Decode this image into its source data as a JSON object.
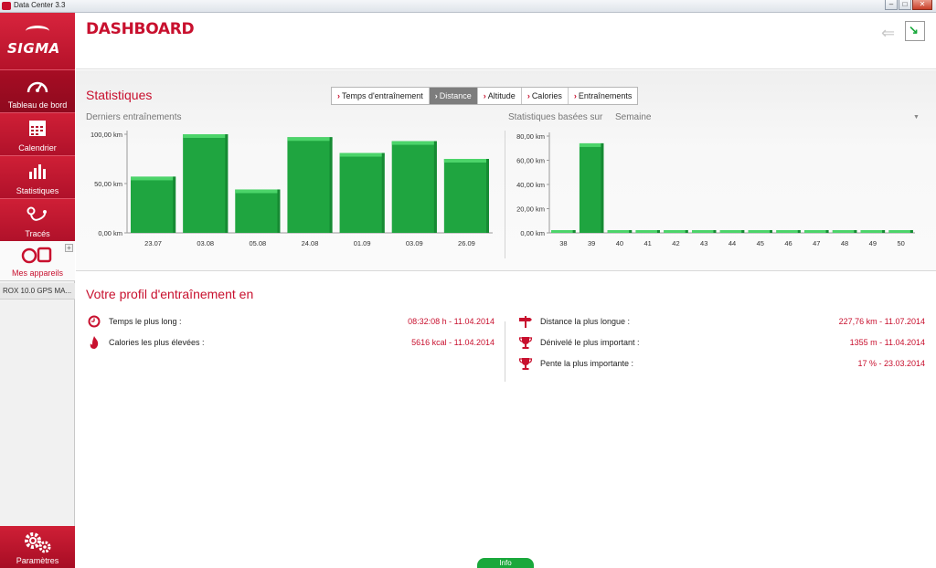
{
  "window": {
    "title": "Data Center 3.3",
    "controls": {
      "minimize": "–",
      "maximize": "□",
      "close": "✕"
    }
  },
  "sidebar": {
    "logo": "SIGMA",
    "items": [
      {
        "label": "Tableau de bord",
        "icon": "speedometer-icon",
        "active": true
      },
      {
        "label": "Calendrier",
        "icon": "calendar-icon",
        "active": false
      },
      {
        "label": "Statistiques",
        "icon": "bar-chart-icon",
        "active": false
      },
      {
        "label": "Tracés",
        "icon": "route-icon",
        "active": false
      }
    ],
    "devices": {
      "label": "Mes appareils",
      "icon": "watch-device-icon",
      "add": "+"
    },
    "device_name": "ROX 10.0 GPS MA...",
    "settings": {
      "label": "Paramètres",
      "icon": "gears-icon"
    }
  },
  "header": {
    "title": "DASHBOARD",
    "back_icon": "back-arrow-icon",
    "export_icon": "export-icon"
  },
  "statistics": {
    "title": "Statistiques",
    "tabs": [
      {
        "label": "Temps d'entraînement",
        "active": false
      },
      {
        "label": "Distance",
        "active": true
      },
      {
        "label": "Altitude",
        "active": false
      },
      {
        "label": "Calories",
        "active": false
      },
      {
        "label": "Entraînements",
        "active": false
      }
    ],
    "left_chart_title": "Derniers entraînements",
    "right_chart_title": "Statistiques basées sur",
    "period_value": "Semaine"
  },
  "chart_data": [
    {
      "type": "bar",
      "title": "Derniers entraînements",
      "categories": [
        "23.07",
        "03.08",
        "05.08",
        "24.08",
        "01.09",
        "03.09",
        "26.09"
      ],
      "values": [
        57,
        100,
        44,
        97,
        81,
        93,
        75
      ],
      "ylim": [
        0,
        100
      ],
      "yticks": [
        {
          "value": 0,
          "label": "0,00 km"
        },
        {
          "value": 50,
          "label": "50,00 km"
        },
        {
          "value": 100,
          "label": "100,00 km"
        }
      ],
      "color": "#1fa540",
      "grid": false
    },
    {
      "type": "bar",
      "title": "Statistiques basées sur",
      "categories": [
        "38",
        "39",
        "40",
        "41",
        "42",
        "43",
        "44",
        "45",
        "46",
        "47",
        "48",
        "49",
        "50"
      ],
      "values": [
        0,
        74,
        0,
        0,
        0,
        0,
        0,
        0,
        0,
        0,
        0,
        0,
        0
      ],
      "ylim": [
        0,
        80
      ],
      "yticks": [
        {
          "value": 0,
          "label": "0,00 km"
        },
        {
          "value": 20,
          "label": "20,00 km"
        },
        {
          "value": 40,
          "label": "40,00 km"
        },
        {
          "value": 60,
          "label": "60,00 km"
        },
        {
          "value": 80,
          "label": "80,00 km"
        }
      ],
      "color": "#1fa540",
      "grid": false
    }
  ],
  "profile": {
    "title": "Votre profil d'entraînement en",
    "left": [
      {
        "label": "Temps le plus long :",
        "value": "08:32:08 h - 11.04.2014",
        "icon": "clock-icon"
      },
      {
        "label": "Calories les plus élevées :",
        "value": "5616 kcal - 11.04.2014",
        "icon": "flame-icon"
      }
    ],
    "right": [
      {
        "label": "Distance la plus longue :",
        "value": "227,76 km - 11.07.2014",
        "icon": "signpost-icon"
      },
      {
        "label": "Dénivelé le plus important :",
        "value": "1355 m - 11.04.2014",
        "icon": "trophy-icon"
      },
      {
        "label": "Pente la plus importante :",
        "value": "17 % - 23.03.2014",
        "icon": "trophy-icon"
      }
    ]
  },
  "info_tab": "Info",
  "colors": {
    "accent": "#c8102e",
    "bar": "#1fa540"
  }
}
